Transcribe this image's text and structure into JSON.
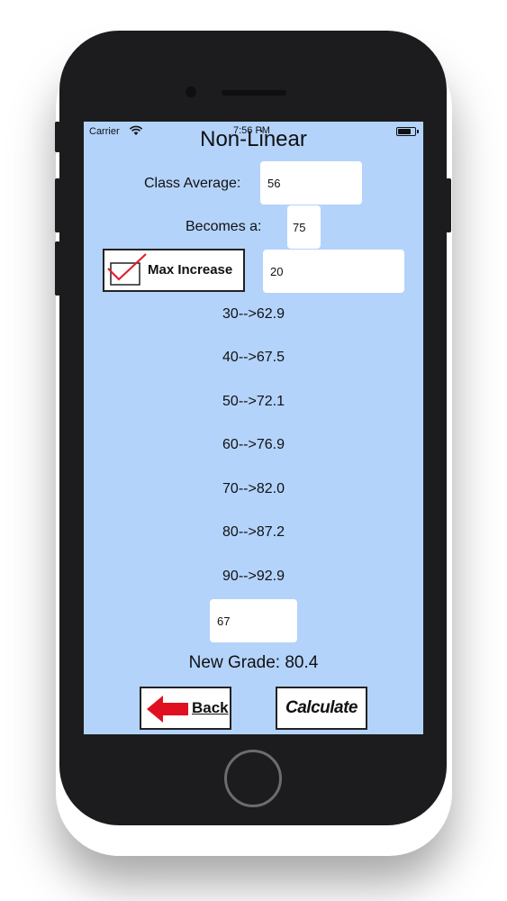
{
  "status_bar": {
    "carrier": "Carrier",
    "time": "7:56 PM",
    "wifi_icon": "wifi-icon",
    "battery_icon": "battery-icon"
  },
  "screen": {
    "title": "Non-Linear",
    "class_average_label": "Class Average:",
    "class_average_value": "56",
    "becomes_label": "Becomes a:",
    "becomes_value": "75",
    "max_increase_label": "Max Increase",
    "max_increase_checked": true,
    "max_increase_value": "20",
    "mappings": [
      "30-->62.9",
      "40-->67.5",
      "50-->72.1",
      "60-->76.9",
      "70-->82.0",
      "80-->87.2",
      "90-->92.9"
    ],
    "grade_input_value": "67",
    "new_grade_text": "New Grade: 80.4",
    "back_label": "Back",
    "calculate_label": "Calculate"
  },
  "colors": {
    "screen_background": "#b3d3fb",
    "phone_body": "#1c1c1e",
    "check_mark": "#e0202a",
    "back_arrow": "#e01020"
  }
}
